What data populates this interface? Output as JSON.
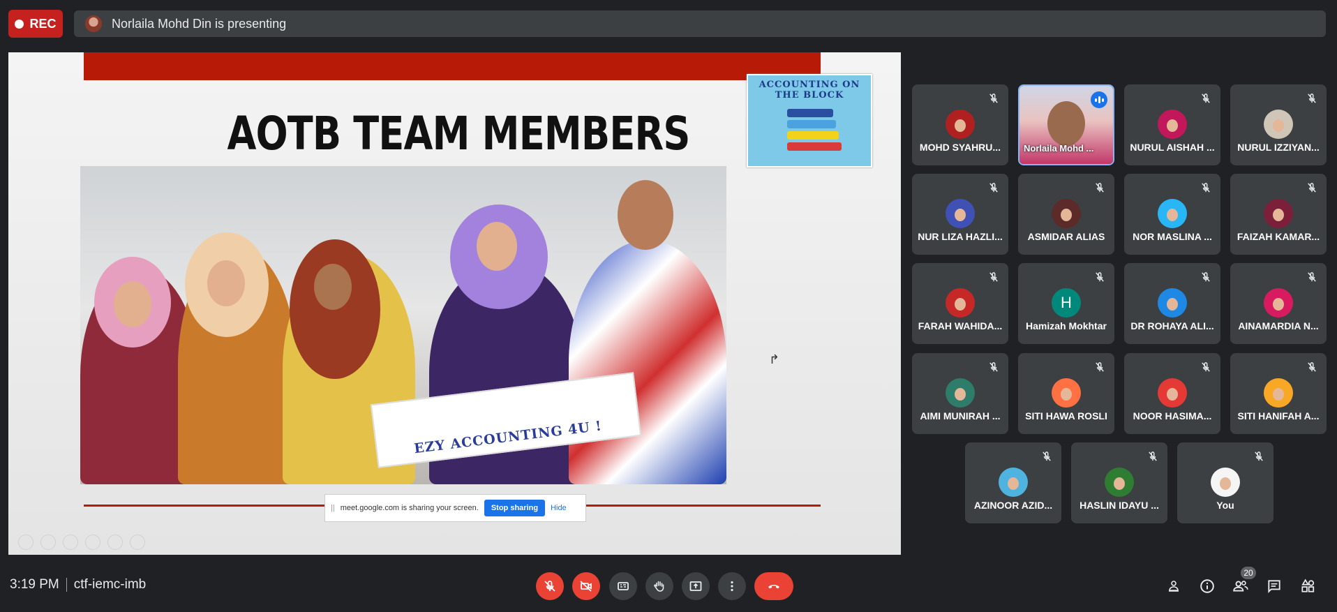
{
  "recording": {
    "label": "REC"
  },
  "presenting": {
    "text": "Norlaila Mohd Din is presenting"
  },
  "slide": {
    "title": "AOTB TEAM MEMBERS",
    "logo_text": "ACCOUNTING ON THE BLOCK",
    "banner_text": "EZY ACCOUNTING 4U !"
  },
  "share_banner": {
    "message": "meet.google.com is sharing your screen.",
    "stop_label": "Stop sharing",
    "hide_label": "Hide"
  },
  "participants": [
    {
      "name": "MOHD SYAHRU...",
      "muted": true
    },
    {
      "name": "Norlaila Mohd ...",
      "speaking": true
    },
    {
      "name": "NURUL AISHAH ...",
      "muted": true
    },
    {
      "name": "NURUL IZZIYAN...",
      "muted": true
    },
    {
      "name": "NUR LIZA HAZLI...",
      "muted": true
    },
    {
      "name": "ASMIDAR ALIAS",
      "muted": true
    },
    {
      "name": "NOR MASLINA ...",
      "muted": true
    },
    {
      "name": "FAIZAH KAMAR...",
      "muted": true
    },
    {
      "name": "FARAH WAHIDA...",
      "muted": true
    },
    {
      "name": "Hamizah Mokhtar",
      "muted": true,
      "initial": "H"
    },
    {
      "name": "DR ROHAYA ALI...",
      "muted": true
    },
    {
      "name": "AINAMARDIA N...",
      "muted": true
    },
    {
      "name": "AIMI MUNIRAH ...",
      "muted": true
    },
    {
      "name": "SITI HAWA ROSLI",
      "muted": true
    },
    {
      "name": "NOOR HASIMA...",
      "muted": true
    },
    {
      "name": "SITI HANIFAH A...",
      "muted": true
    },
    {
      "name": "AZINOOR AZID...",
      "muted": true
    },
    {
      "name": "HASLIN IDAYU ...",
      "muted": true
    },
    {
      "name": "You",
      "muted": true
    }
  ],
  "meeting": {
    "time": "3:19 PM",
    "code": "ctf-iemc-imb"
  },
  "people_count": "20",
  "colors": {
    "background": "#202124",
    "tile": "#3c4043",
    "danger": "#ea4335",
    "accent": "#1a73e8",
    "speaking_border": "#8ab4f8"
  },
  "icons": {
    "controls": [
      "mic-off-icon",
      "camera-off-icon",
      "captions-icon",
      "raise-hand-icon",
      "present-icon",
      "more-options-icon",
      "end-call-icon"
    ],
    "right": [
      "host-controls-icon",
      "info-icon",
      "people-icon",
      "chat-icon",
      "activities-icon"
    ]
  }
}
